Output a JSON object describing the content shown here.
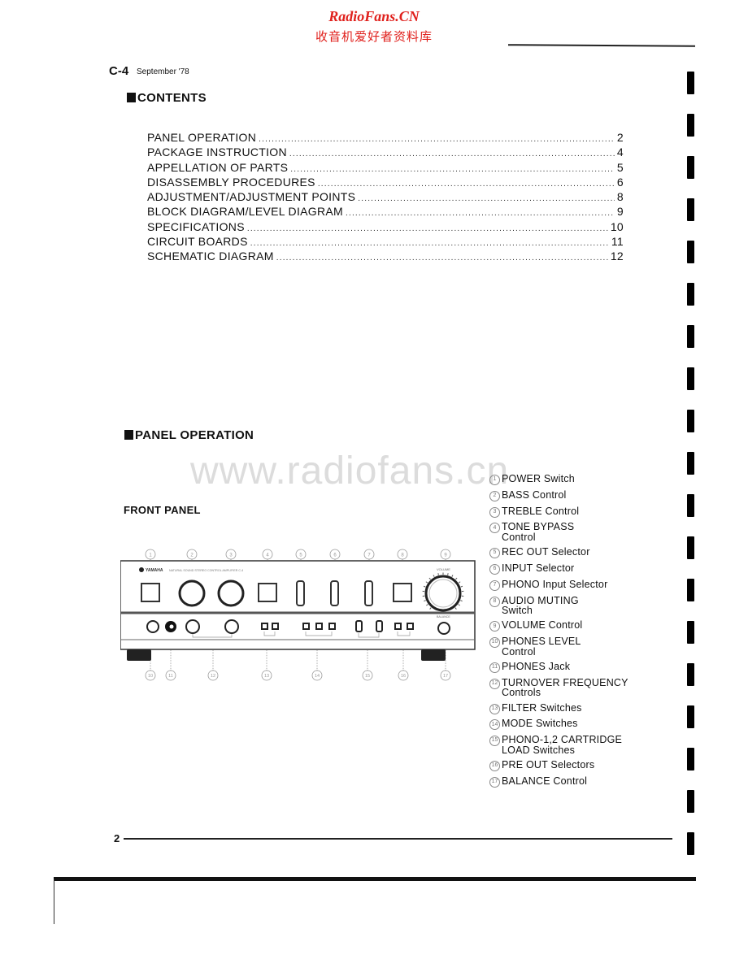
{
  "watermark": {
    "site_title": "RadioFans.CN",
    "site_subtitle": "收音机爱好者资料库",
    "url_text": "www.radiofans.cn"
  },
  "header": {
    "model": "C-4",
    "date": "September '78"
  },
  "contents": {
    "heading": "CONTENTS",
    "items": [
      {
        "title": "PANEL OPERATION",
        "page": "2"
      },
      {
        "title": "PACKAGE INSTRUCTION",
        "page": "4"
      },
      {
        "title": "APPELLATION OF PARTS",
        "page": "5"
      },
      {
        "title": "DISASSEMBLY PROCEDURES",
        "page": "6"
      },
      {
        "title": "ADJUSTMENT/ADJUSTMENT POINTS",
        "page": "8"
      },
      {
        "title": "BLOCK DIAGRAM/LEVEL DIAGRAM",
        "page": "9"
      },
      {
        "title": "SPECIFICATIONS",
        "page": "10"
      },
      {
        "title": "CIRCUIT BOARDS",
        "page": "11"
      },
      {
        "title": "SCHEMATIC DIAGRAM",
        "page": "12"
      }
    ]
  },
  "panel_operation": {
    "heading": "PANEL OPERATION",
    "subheading": "FRONT PANEL",
    "panel_labels": {
      "brand": "YAMAHA",
      "model_line": "NATURAL SOUND STEREO CONTROL AMPLIFIER C-4",
      "volume": "VOLUME",
      "balance": "BALANCE"
    },
    "legend": [
      {
        "num": "1",
        "text": "POWER Switch"
      },
      {
        "num": "2",
        "text": "BASS Control"
      },
      {
        "num": "3",
        "text": "TREBLE Control"
      },
      {
        "num": "4",
        "text": "TONE BYPASS\nControl"
      },
      {
        "num": "5",
        "text": "REC OUT Selector"
      },
      {
        "num": "6",
        "text": "INPUT Selector"
      },
      {
        "num": "7",
        "text": "PHONO Input Selector"
      },
      {
        "num": "8",
        "text": "AUDIO MUTING\nSwitch"
      },
      {
        "num": "9",
        "text": "VOLUME Control"
      },
      {
        "num": "10",
        "text": "PHONES LEVEL\nControl"
      },
      {
        "num": "11",
        "text": "PHONES Jack"
      },
      {
        "num": "12",
        "text": "TURNOVER FREQUENCY\nControls"
      },
      {
        "num": "13",
        "text": "FILTER Switches"
      },
      {
        "num": "14",
        "text": "MODE Switches"
      },
      {
        "num": "15",
        "text": "PHONO-1,2 CARTRIDGE\nLOAD Switches"
      },
      {
        "num": "16",
        "text": "PRE OUT Selectors"
      },
      {
        "num": "17",
        "text": "BALANCE Control"
      }
    ],
    "callouts_top": [
      "1",
      "2",
      "3",
      "4",
      "5",
      "6",
      "7",
      "8",
      "9"
    ],
    "callouts_bottom": [
      "10",
      "11",
      "12",
      "13",
      "14",
      "15",
      "16",
      "17"
    ]
  },
  "footer": {
    "page_number": "2"
  }
}
